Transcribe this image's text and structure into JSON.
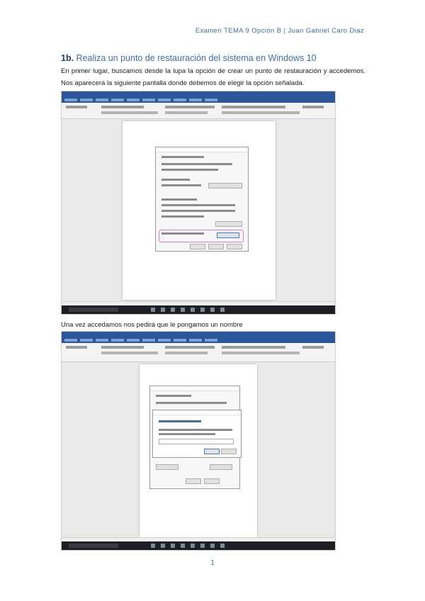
{
  "header": "Examen TEMA 9 Opción B | Juan Gabriel Caro Diaz",
  "section": {
    "number": "1b.",
    "title": "Realiza un punto de restauración del sistema en Windows 10"
  },
  "paragraph": "En primer lugar, buscamos desde la lupa la opción de crear un punto de restauración y accedemos. Nos aparecerá la siguiente pantalla donde debemos de elegir la opción señalada.",
  "caption2": "Una vez accedamos nos pedirá que le pongamos un nombre",
  "page_number": "1",
  "screenshots": [
    {
      "name": "screenshot-system-properties",
      "dialog_title": "Propiedades del sistema",
      "button": "Crear"
    },
    {
      "name": "screenshot-restore-name",
      "dialog_title": "Protección del sistema",
      "button": "Crear"
    }
  ]
}
